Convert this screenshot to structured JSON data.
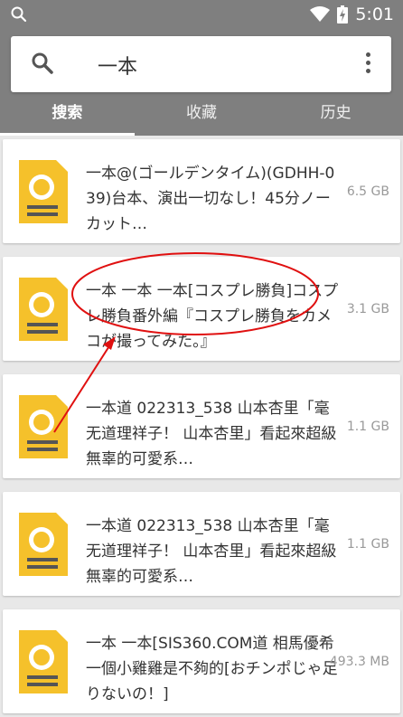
{
  "search": {
    "query": "一本"
  },
  "status": {
    "time": "5:01"
  },
  "tabs": [
    {
      "label": "搜索",
      "active": true
    },
    {
      "label": "收藏",
      "active": false
    },
    {
      "label": "历史",
      "active": false
    }
  ],
  "results": [
    {
      "title": "一本@(ゴールデンタイム)(GDHH-039)台本、演出一切なし！45分ノーカット…",
      "size": "6.5 GB"
    },
    {
      "title": "一本 一本 一本[コスプレ勝負]コスプレ勝負番外編『コスプレ勝負をカメコが撮ってみた。』",
      "size": "3.1 GB"
    },
    {
      "title": "一本道 022313_538 山本杏里「毫无道理祥子！ 山本杏里」看起來超級無辜的可愛系…",
      "size": "1.1 GB"
    },
    {
      "title": "一本道 022313_538 山本杏里「毫无道理祥子！ 山本杏里」看起來超級無辜的可愛系…",
      "size": "1.1 GB"
    },
    {
      "title": "一本 一本[SIS360.COM道 相馬優希 一個小雞雞是不夠的[おチンポじゃ足りないの！]",
      "size": "493.3 MB"
    }
  ],
  "colors": {
    "appbar": "#7f7f7f",
    "file_icon": "#f5c12b",
    "annotation": "#e01010"
  }
}
